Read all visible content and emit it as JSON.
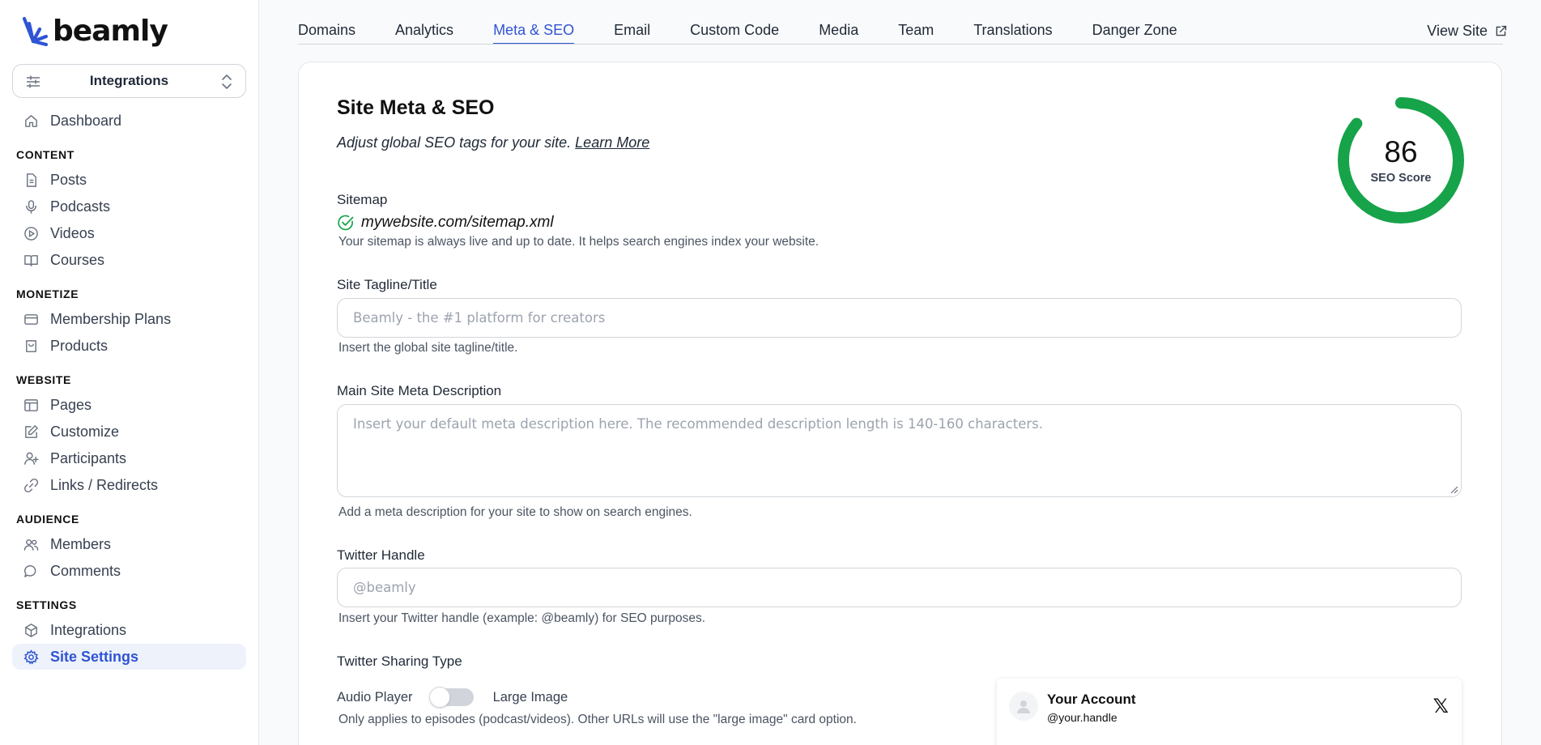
{
  "brand": {
    "name": "beamly",
    "accent": "#2f54d4"
  },
  "site_select": {
    "label": "Integrations"
  },
  "nav": {
    "dashboard": "Dashboard",
    "sections": {
      "content": "CONTENT",
      "monetize": "MONETIZE",
      "website": "WEBSITE",
      "audience": "AUDIENCE",
      "settings": "SETTINGS"
    },
    "items": {
      "posts": "Posts",
      "podcasts": "Podcasts",
      "videos": "Videos",
      "courses": "Courses",
      "membership_plans": "Membership Plans",
      "products": "Products",
      "pages": "Pages",
      "customize": "Customize",
      "participants": "Participants",
      "links": "Links / Redirects",
      "members": "Members",
      "comments": "Comments",
      "integrations": "Integrations",
      "site_settings": "Site Settings"
    }
  },
  "tabs": [
    "Domains",
    "Analytics",
    "Meta & SEO",
    "Email",
    "Custom Code",
    "Media",
    "Team",
    "Translations",
    "Danger Zone"
  ],
  "active_tab": "Meta & SEO",
  "view_site": "View Site",
  "page": {
    "title": "Site Meta & SEO",
    "subtitle": "Adjust global SEO tags for your site.",
    "learn_more": "Learn More"
  },
  "sitemap": {
    "label": "Sitemap",
    "url": "mywebsite.com/sitemap.xml",
    "help": "Your sitemap is always live and up to date. It helps search engines index your website."
  },
  "tagline": {
    "label": "Site Tagline/Title",
    "placeholder": "Beamly - the #1 platform for creators",
    "help": "Insert the global site tagline/title."
  },
  "meta_description": {
    "label": "Main Site Meta Description",
    "placeholder": "Insert your default meta description here. The recommended description length is 140-160 characters.",
    "help": "Add a meta description for your site to show on search engines."
  },
  "twitter_handle": {
    "label": "Twitter Handle",
    "placeholder": "@beamly",
    "help": "Insert your Twitter handle (example: @beamly) for SEO purposes."
  },
  "twitter_sharing": {
    "label": "Twitter Sharing Type",
    "option_left": "Audio Player",
    "option_right": "Large Image",
    "help": "Only applies to episodes (podcast/videos). Other URLs will use the \"large image\" card option."
  },
  "seo_score": {
    "value": "86",
    "label": "SEO Score",
    "percent": 86,
    "color": "#16a34a"
  },
  "twitter_preview": {
    "account": "Your Account",
    "handle": "@your.handle",
    "logo": "𝕏"
  }
}
